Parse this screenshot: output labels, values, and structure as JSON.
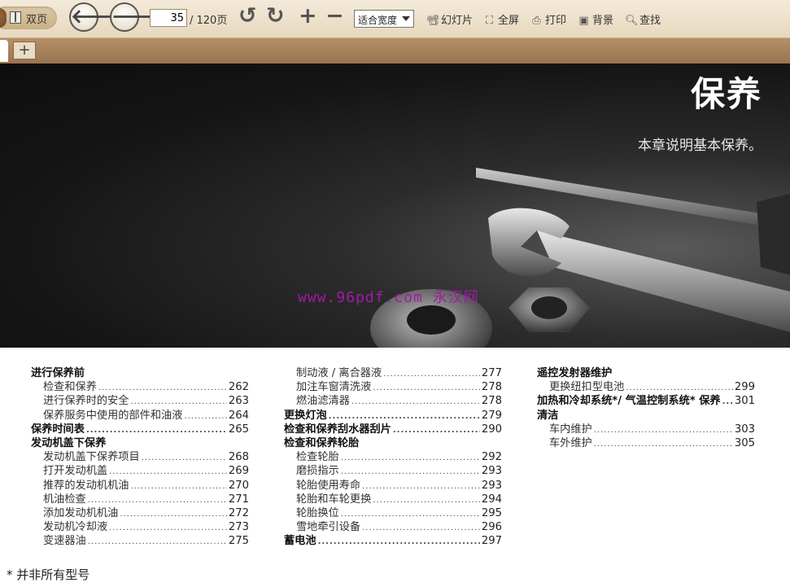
{
  "toolbar": {
    "dual_page_label": "双页",
    "current_page": "35",
    "total_pages": "/ 120页",
    "zoom_option": "适合宽度",
    "slideshow_label": "幻灯片",
    "fullscreen_label": "全屏",
    "print_label": "打印",
    "background_label": "背景",
    "search_label": "查找",
    "add_tab_label": "+"
  },
  "hero": {
    "title": "保养",
    "subtitle": "本章说明基本保养。",
    "watermark": "www.96pdf.com 永汉网"
  },
  "toc": {
    "col1": [
      {
        "title": "进行保养前",
        "page": "",
        "level": 1
      },
      {
        "title": "检查和保养",
        "page": "262",
        "level": 2
      },
      {
        "title": "进行保养时的安全",
        "page": "263",
        "level": 2
      },
      {
        "title": "保养服务中使用的部件和油液",
        "page": "264",
        "level": 2
      },
      {
        "title": "保养时间表",
        "page": "265",
        "level": 1
      },
      {
        "title": "发动机盖下保养",
        "page": "",
        "level": 1
      },
      {
        "title": "发动机盖下保养项目",
        "page": "268",
        "level": 2
      },
      {
        "title": "打开发动机盖",
        "page": "269",
        "level": 2
      },
      {
        "title": "推荐的发动机机油",
        "page": "270",
        "level": 2
      },
      {
        "title": "机油检查",
        "page": "271",
        "level": 2
      },
      {
        "title": "添加发动机机油",
        "page": "272",
        "level": 2
      },
      {
        "title": "发动机冷却液",
        "page": "273",
        "level": 2
      },
      {
        "title": "变速器油",
        "page": "275",
        "level": 2
      }
    ],
    "col2": [
      {
        "title": "制动液 / 离合器液",
        "page": "277",
        "level": 2
      },
      {
        "title": "加注车窗清洗液",
        "page": "278",
        "level": 2
      },
      {
        "title": "燃油滤清器",
        "page": "278",
        "level": 2
      },
      {
        "title": "更换灯泡",
        "page": "279",
        "level": 1
      },
      {
        "title": "检查和保养刮水器刮片",
        "page": "290",
        "level": 1
      },
      {
        "title": "检查和保养轮胎",
        "page": "",
        "level": 1
      },
      {
        "title": "检查轮胎",
        "page": "292",
        "level": 2
      },
      {
        "title": "磨损指示",
        "page": "293",
        "level": 2
      },
      {
        "title": "轮胎使用寿命",
        "page": "293",
        "level": 2
      },
      {
        "title": "轮胎和车轮更换",
        "page": "294",
        "level": 2
      },
      {
        "title": "轮胎换位",
        "page": "295",
        "level": 2
      },
      {
        "title": "雪地牵引设备",
        "page": "296",
        "level": 2
      },
      {
        "title": "蓄电池",
        "page": "297",
        "level": 1
      }
    ],
    "col3": [
      {
        "title": "遥控发射器维护",
        "page": "",
        "level": 1
      },
      {
        "title": "更换纽扣型电池",
        "page": "299",
        "level": 2
      },
      {
        "title": "加热和冷却系统*/ 气温控制系统* 保养",
        "page": "301",
        "level": 1
      },
      {
        "title": "清洁",
        "page": "",
        "level": 1
      },
      {
        "title": "车内维护",
        "page": "303",
        "level": 2
      },
      {
        "title": "车外维护",
        "page": "305",
        "level": 2
      }
    ]
  },
  "footnote": "* 并非所有型号"
}
